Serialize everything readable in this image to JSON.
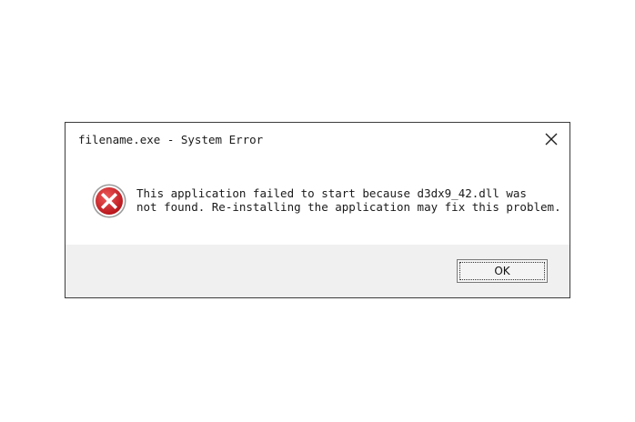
{
  "window": {
    "title": "filename.exe - System Error",
    "close_icon": "close-icon"
  },
  "message": {
    "icon": "error-x-icon",
    "line1": "This application failed to start because d3dx9_42.dll was",
    "line2": "not found. Re-installing the application may fix this problem."
  },
  "buttons": {
    "ok_label": "OK"
  },
  "colors": {
    "error_icon_red": "#d13438",
    "footer_background": "#f0f0f0",
    "border": "#3c3c3c"
  }
}
